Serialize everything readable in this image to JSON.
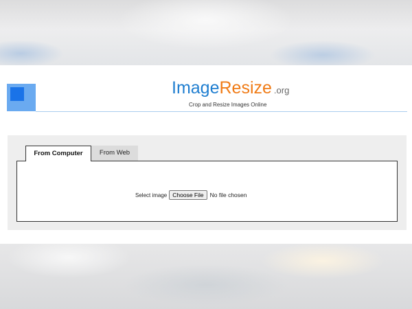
{
  "header": {
    "brand_image": "Image",
    "brand_resize": "Resize",
    "brand_org": ".org",
    "tagline": "Crop and Resize Images Online"
  },
  "tabs": [
    {
      "label": "From Computer",
      "active": true
    },
    {
      "label": "From Web",
      "active": false
    }
  ],
  "upload": {
    "select_label": "Select image",
    "button_label": "Choose File",
    "file_status": "No file chosen"
  },
  "colors": {
    "brand_blue": "#1f7ed0",
    "brand_orange": "#f07b16",
    "logo_light": "#6aaaf0",
    "logo_dark": "#1a73e8"
  },
  "icons": {
    "logo": "logo-square-icon"
  }
}
